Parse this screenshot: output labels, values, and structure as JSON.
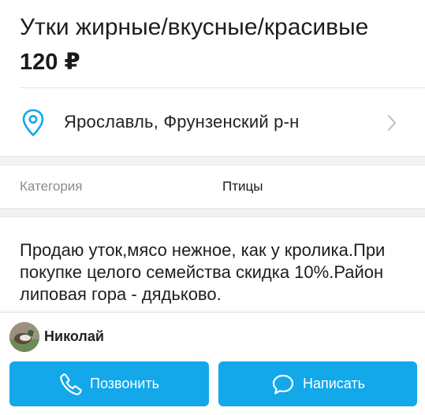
{
  "ad": {
    "title": "Утки жирные/вкусные/красивые",
    "price": "120 ₽"
  },
  "location": {
    "text": "Ярославль, Фрунзенский р-н",
    "icon": "map-pin-icon",
    "chevron": "chevron-right-icon"
  },
  "params": {
    "category_label": "Категория",
    "category_value": "Птицы"
  },
  "description": "Продаю уток,мясо нежное, как у кролика.При покупке целого семейства скидка 10%.Район липовая гора - дядьково.",
  "seller": {
    "name": "Николай"
  },
  "actions": {
    "call_label": "Позвонить",
    "write_label": "Написать"
  },
  "colors": {
    "accent": "#12a8ea",
    "divider": "#e6e6e6",
    "muted_text": "#8c8c8c",
    "section_gap": "#f2f2f2"
  }
}
